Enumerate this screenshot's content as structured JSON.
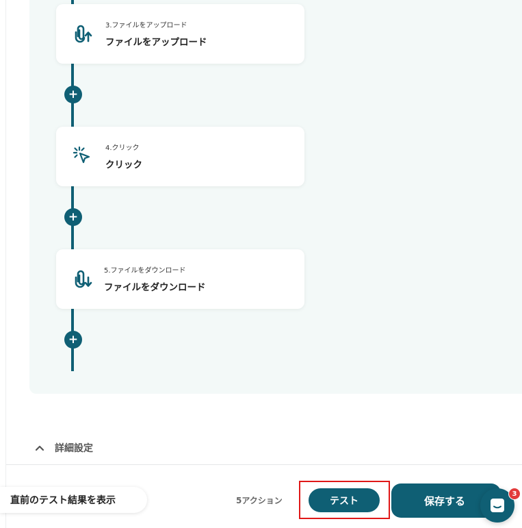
{
  "colors": {
    "primary": "#0f5f74",
    "canvas_bg": "#f3f9f8",
    "highlight": "#e01818",
    "badge": "#e23a3a"
  },
  "steps": [
    {
      "number_label": "3.ファイルをアップロード",
      "title": "ファイルをアップロード",
      "icon": "file-upload-icon"
    },
    {
      "number_label": "4.クリック",
      "title": "クリック",
      "icon": "click-cursor-icon"
    },
    {
      "number_label": "5.ファイルをダウンロード",
      "title": "ファイルをダウンロード",
      "icon": "file-download-icon"
    }
  ],
  "add_step": {
    "symbol": "+"
  },
  "advanced_settings": {
    "label": "詳細設定",
    "icon": "chevron-up-icon"
  },
  "footer": {
    "prev_result_label": "直前のテスト結果を表示",
    "action_count": "5アクション",
    "test_label": "テスト",
    "save_label": "保存する",
    "chat_icon": "chat-icon",
    "chat_badge_count": "3"
  }
}
